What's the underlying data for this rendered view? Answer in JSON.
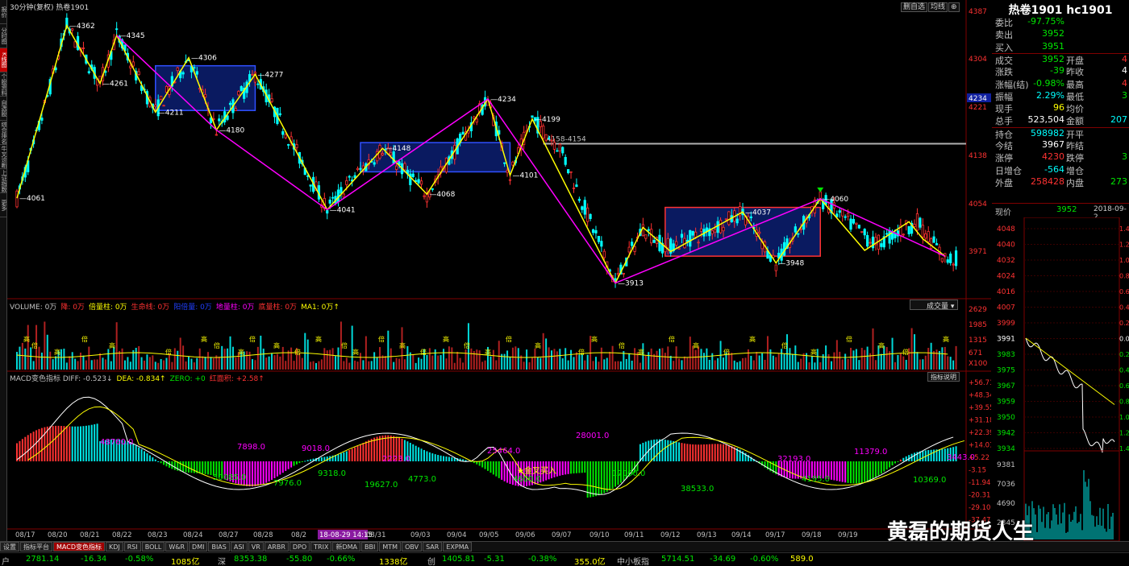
{
  "left_tabs": [
    "报价",
    "分时图",
    "K线图",
    "个股资料",
    "自选股",
    "综合排名",
    "牛叉诊断",
    "上证指数",
    "更多"
  ],
  "main_chart": {
    "title": "30分钟(复权) 热卷1901",
    "top_buttons": [
      "删自选",
      "均线",
      "⊕"
    ],
    "price_axis": [
      "4387",
      "4304",
      "4221",
      "4138",
      "4054",
      "3971"
    ],
    "current_price_tag": "4234",
    "level_line_label": "4158-4154",
    "swing_labels": [
      {
        "text": "4362"
      },
      {
        "text": "4345"
      },
      {
        "text": "4261"
      },
      {
        "text": "4306"
      },
      {
        "text": "4211"
      },
      {
        "text": "4277"
      },
      {
        "text": "4180"
      },
      {
        "text": "4061"
      },
      {
        "text": "4234"
      },
      {
        "text": "4199"
      },
      {
        "text": "4041"
      },
      {
        "text": "4148"
      },
      {
        "text": "4068"
      },
      {
        "text": "4101"
      },
      {
        "text": "3913"
      },
      {
        "text": "4037"
      },
      {
        "text": "4060"
      },
      {
        "text": "3948"
      }
    ]
  },
  "volume_panel": {
    "legend": [
      {
        "text": "VOLUME: 0万",
        "color": "#c0c0c0"
      },
      {
        "text": "降: 0万",
        "color": "#ff3232"
      },
      {
        "text": "倍量柱: 0万",
        "color": "#ffff00"
      },
      {
        "text": "生命线: 0万",
        "color": "#ff3232"
      },
      {
        "text": "阳倍量: 0万",
        "color": "#2040ff"
      },
      {
        "text": "地量柱: 0万",
        "color": "#ff00ff"
      },
      {
        "text": "底量柱: 0万",
        "color": "#ff3232"
      },
      {
        "text": "MA1: 0万↑",
        "color": "#ffff00"
      }
    ],
    "dropdown": "成交量",
    "axis": [
      "2629",
      "1985",
      "1315",
      "671",
      "X100"
    ],
    "tags": [
      "高",
      "倍"
    ]
  },
  "macd_panel": {
    "legend": [
      {
        "text": "MACD变色指标 DIFF: -0.523↓",
        "color": "#c0c0c0"
      },
      {
        "text": "DEA: -0.834↑",
        "color": "#ffff00"
      },
      {
        "text": "ZERO: +0",
        "color": "#00e600"
      },
      {
        "text": "红面积: +2.58↑",
        "color": "#ff3232"
      }
    ],
    "help_button": "指标说明",
    "axis": [
      "+56.71",
      "+48.34",
      "+39.55",
      "+31.18",
      "+22.39",
      "+14.01",
      "+5.22",
      "-3.15",
      "-11.94",
      "-20.31",
      "-29.10",
      "-37.47"
    ],
    "area_labels": [
      {
        "text": "48760.0",
        "color": "#ff00ff"
      },
      {
        "text": "7898.0",
        "color": "#ff00ff"
      },
      {
        "text": "9018.0",
        "color": "#ff00ff"
      },
      {
        "text": "2223.0",
        "color": "#ff00ff"
      },
      {
        "text": "25464.0",
        "color": "#ff00ff"
      },
      {
        "text": "28001.0",
        "color": "#ff00ff"
      },
      {
        "text": "32193.0",
        "color": "#ff00ff"
      },
      {
        "text": "11379.0",
        "color": "#ff00ff"
      },
      {
        "text": "3443.0",
        "color": "#ff00ff"
      },
      {
        "text": "50085.0",
        "color": "#00e600"
      },
      {
        "text": "7976.0",
        "color": "#00e600"
      },
      {
        "text": "9318.0",
        "color": "#00e600"
      },
      {
        "text": "19627.0",
        "color": "#00e600"
      },
      {
        "text": "4773.0",
        "color": "#00e600"
      },
      {
        "text": "4600.0",
        "color": "#00e600"
      },
      {
        "text": "17000.0",
        "color": "#00e600"
      },
      {
        "text": "38533.0",
        "color": "#00e600"
      },
      {
        "text": "4195.0",
        "color": "#00e600"
      },
      {
        "text": "10369.0",
        "color": "#00e600"
      }
    ],
    "signal_label": "★金叉买入"
  },
  "date_axis": [
    "08/17",
    "08/20",
    "08/21",
    "08/22",
    "08/23",
    "08/24",
    "08/27",
    "08/28",
    "08/2",
    "18-08-29 14:15",
    "08/31",
    "09/03",
    "09/04",
    "09/05",
    "09/06",
    "09/07",
    "09/10",
    "09/11",
    "09/12",
    "09/13",
    "09/14",
    "09/17",
    "09/18",
    "09/19"
  ],
  "quote_panel": {
    "title": "热卷1901 hc1901",
    "rows": [
      {
        "l": "委比",
        "v": "-97.75%",
        "vc": "green",
        "l2": "",
        "v2": "",
        "v2c": ""
      },
      {
        "l": "卖出",
        "v": "3952",
        "vc": "green",
        "l2": "",
        "v2": "",
        "v2c": ""
      },
      {
        "l": "买入",
        "v": "3951",
        "vc": "green",
        "l2": "",
        "v2": "",
        "v2c": ""
      },
      {
        "l": "成交",
        "v": "3952",
        "vc": "green",
        "l2": "开盘",
        "v2": "4",
        "v2c": "red"
      },
      {
        "l": "涨跌",
        "v": "-39",
        "vc": "green",
        "l2": "昨收",
        "v2": "4",
        "v2c": "white"
      },
      {
        "l": "涨幅(结)",
        "v": "-0.98%",
        "vc": "green",
        "l2": "最高",
        "v2": "4",
        "v2c": "red"
      },
      {
        "l": "振幅",
        "v": "2.29%",
        "vc": "cyan",
        "l2": "最低",
        "v2": "3",
        "v2c": "green"
      },
      {
        "l": "现手",
        "v": "96",
        "vc": "yellow",
        "l2": "均价",
        "v2": "",
        "v2c": "yellow"
      },
      {
        "l": "总手",
        "v": "523,504",
        "vc": "white",
        "l2": "金额",
        "v2": "207",
        "v2c": "cyan"
      },
      {
        "l": "持仓",
        "v": "598982",
        "vc": "cyan",
        "l2": "开平",
        "v2": "",
        "v2c": "white"
      },
      {
        "l": "今结",
        "v": "3967",
        "vc": "white",
        "l2": "昨结",
        "v2": "",
        "v2c": "white"
      },
      {
        "l": "涨停",
        "v": "4230",
        "vc": "red",
        "l2": "跌停",
        "v2": "3",
        "v2c": "green"
      },
      {
        "l": "日增仓",
        "v": "-564",
        "vc": "cyan",
        "l2": "增仓",
        "v2": "",
        "v2c": "white"
      },
      {
        "l": "外盘",
        "v": "258428",
        "vc": "red",
        "l2": "内盘",
        "v2": "273",
        "v2c": "green"
      }
    ],
    "now_label": "现价",
    "now_value": "3952",
    "now_date": "2018-09-2",
    "mini_axis": [
      "4048",
      "4040",
      "4032",
      "4024",
      "4016",
      "4007",
      "3999",
      "3991",
      "3983",
      "3975",
      "3967",
      "3959",
      "3950",
      "3942",
      "3934"
    ],
    "mini_axis_right": [
      "1.4",
      "1.2",
      "1.0",
      "0.8",
      "0.6",
      "0.4",
      "0.2",
      "0.0",
      "0.2",
      "0.4",
      "0.6",
      "0.8",
      "1.0",
      "1.2",
      "1.4"
    ],
    "mini_vol_axis": [
      "9381",
      "7036",
      "4690",
      "2345"
    ]
  },
  "toolbar": [
    "设置",
    "指标平台",
    "MACD变色指标",
    "KDJ",
    "RSI",
    "BOLL",
    "W&R",
    "DMI",
    "BIAS",
    "ASI",
    "VR",
    "ARBR",
    "DPO",
    "TRIX",
    "新DMA",
    "BBI",
    "MTM",
    "OBV",
    "SAR",
    "EXPMA"
  ],
  "toolbar_active": 2,
  "status_bar": [
    {
      "text": "户",
      "color": "#c0c0c0"
    },
    {
      "text": "2781.14",
      "color": "#00e600"
    },
    {
      "text": "-16.34",
      "color": "#00e600"
    },
    {
      "text": "-0.58%",
      "color": "#00e600"
    },
    {
      "text": "1085亿",
      "color": "#ffff00"
    },
    {
      "text": "深",
      "color": "#c0c0c0"
    },
    {
      "text": "8353.38",
      "color": "#00e600"
    },
    {
      "text": "-55.80",
      "color": "#00e600"
    },
    {
      "text": "-0.66%",
      "color": "#00e600"
    },
    {
      "text": "1338亿",
      "color": "#ffff00"
    },
    {
      "text": "创",
      "color": "#c0c0c0"
    },
    {
      "text": "1405.81",
      "color": "#00e600"
    },
    {
      "text": "-5.31",
      "color": "#00e600"
    },
    {
      "text": "-0.38%",
      "color": "#00e600"
    },
    {
      "text": "355.0亿",
      "color": "#ffff00"
    },
    {
      "text": "中小板指",
      "color": "#c0c0c0"
    },
    {
      "text": "5714.51",
      "color": "#00e600"
    },
    {
      "text": "-34.69",
      "color": "#00e600"
    },
    {
      "text": "-0.60%",
      "color": "#00e600"
    },
    {
      "text": "589.0",
      "color": "#ffff00"
    }
  ],
  "watermark": "黄磊的期货人生"
}
